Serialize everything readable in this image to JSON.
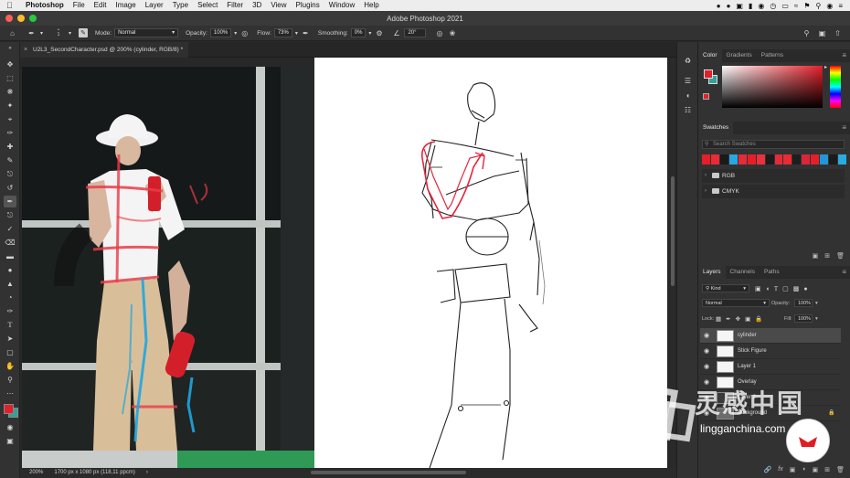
{
  "menubar": {
    "app_name": "Photoshop",
    "items": [
      "File",
      "Edit",
      "Image",
      "Layer",
      "Type",
      "Select",
      "Filter",
      "3D",
      "View",
      "Plugins",
      "Window",
      "Help"
    ]
  },
  "window": {
    "title": "Adobe Photoshop 2021"
  },
  "options": {
    "mode_label": "Mode:",
    "mode_value": "Normal",
    "opacity_label": "Opacity:",
    "opacity_value": "100%",
    "flow_label": "Flow:",
    "flow_value": "73%",
    "smoothing_label": "Smoothing:",
    "smoothing_value": "0%",
    "angle_value": "20°",
    "brush_size": "1"
  },
  "document": {
    "tab_title": "U2L3_SecondCharacter.psd @ 200% (cylinder, RGB/8) *",
    "zoom": "200%",
    "dimensions": "1700 px x 1080 px (118,11 ppcm)"
  },
  "panels": {
    "color_tabs": [
      "Color",
      "Gradients",
      "Patterns"
    ],
    "swatches_title": "Swatches",
    "swatches_search_placeholder": "Search Swatches",
    "swatch_colors": [
      "#e3202a",
      "#ea2a35",
      "#1a1a1a",
      "#2aa7e0",
      "#e52b3a",
      "#e3202a",
      "#eb3140",
      "#1b1b1b",
      "#e52b3a",
      "#ea2a35",
      "#1e1e1e",
      "#d8263a",
      "#e3202a",
      "#2296d8",
      "#1b1b1b",
      "#29abe2"
    ],
    "swatch_groups": [
      "RGB",
      "CMYK"
    ],
    "layers_tabs": [
      "Layers",
      "Channels",
      "Paths"
    ],
    "filter_label": "Kind",
    "blend_mode": "Normal",
    "opacity_label": "Opacity:",
    "opacity_value": "100%",
    "lock_label": "Lock:",
    "fill_label": "Fill:",
    "fill_value": "100%",
    "layers": [
      {
        "name": "cylinder",
        "selected": true
      },
      {
        "name": "Stick Figure",
        "selected": false
      },
      {
        "name": "Layer 1",
        "selected": false
      },
      {
        "name": "Overlay",
        "selected": false
      },
      {
        "name": "Layer 2",
        "selected": false
      },
      {
        "name": "Background",
        "selected": false
      }
    ]
  },
  "colors": {
    "foreground": "#e3202a",
    "background": "#2fa39a",
    "accent_red": "#ea3b48",
    "accent_blue": "#1ea6e0"
  },
  "watermark": {
    "text_cn": "灵感中国",
    "text_url": "lingganchina.com"
  }
}
